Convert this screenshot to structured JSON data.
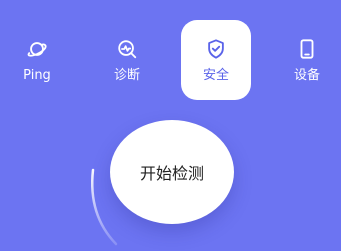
{
  "tabs": [
    {
      "id": "ping",
      "label": "Ping",
      "icon": "planet-icon",
      "active": false
    },
    {
      "id": "diagnose",
      "label": "诊断",
      "icon": "pulse-search-icon",
      "active": false
    },
    {
      "id": "security",
      "label": "安全",
      "icon": "shield-check-icon",
      "active": true
    },
    {
      "id": "device",
      "label": "设备",
      "icon": "phone-icon",
      "active": false
    }
  ],
  "start_button": {
    "label": "开始检测"
  },
  "colors": {
    "background": "#6c74f2",
    "accent": "#5a63e9",
    "surface": "#ffffff",
    "text_on_surface": "#222222"
  }
}
